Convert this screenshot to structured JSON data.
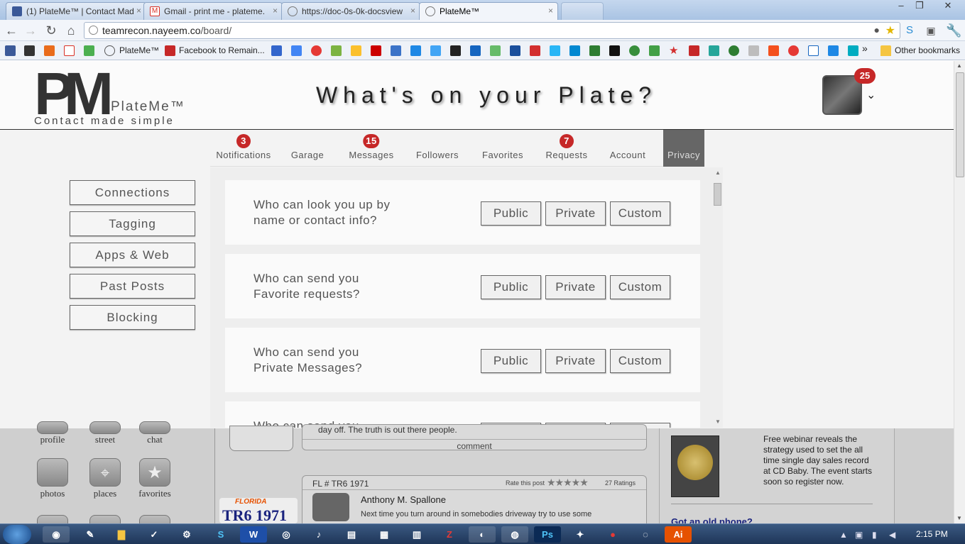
{
  "browser": {
    "tabs": [
      {
        "title": "(1) PlateMe™ | Contact Mad",
        "favicon": "facebook-icon",
        "color": "#3b5998"
      },
      {
        "title": "Gmail - print me - plateme.",
        "favicon": "gmail-icon",
        "color": "#d93025"
      },
      {
        "title": "https://doc-0s-0k-docsview",
        "favicon": "globe-icon",
        "color": "#777777"
      },
      {
        "title": "PlateMe™",
        "favicon": "globe-icon",
        "color": "#777777",
        "active": true
      }
    ],
    "url_domain": "teamrecon.nayeem.co",
    "url_path": "/board/",
    "bookmarks": {
      "plateme": "PlateMe™",
      "facebook_remain": "Facebook to Remain...",
      "other": "Other bookmarks"
    }
  },
  "header": {
    "logo_mark": "PM",
    "logo_name": "PlateMe™",
    "logo_tagline": "Contact made simple",
    "slogan": "What's on your Plate?",
    "avatar_badge": "25"
  },
  "nav": {
    "items": [
      {
        "label": "Notifications",
        "badge": "3"
      },
      {
        "label": "Garage"
      },
      {
        "label": "Messages",
        "badge": "15"
      },
      {
        "label": "Followers"
      },
      {
        "label": "Favorites"
      },
      {
        "label": "Requests",
        "badge": "7"
      },
      {
        "label": "Account"
      },
      {
        "label": "Privacy",
        "active": true
      }
    ]
  },
  "left_menu": [
    "Connections",
    "Tagging",
    "Apps & Web",
    "Past Posts",
    "Blocking"
  ],
  "privacy": {
    "options": [
      "Public",
      "Private",
      "Custom"
    ],
    "questions": [
      {
        "line1": "Who can look you up by",
        "line2": "name or contact info?"
      },
      {
        "line1": "Who can send you",
        "line2": "Favorite requests?"
      },
      {
        "line1": "Who can send you",
        "line2": "Private Messages?"
      },
      {
        "line1": "Who can send you",
        "line2": ""
      }
    ]
  },
  "background": {
    "apps": [
      "profile",
      "street",
      "chat",
      "photos",
      "places",
      "favorites"
    ],
    "post1_text": "day off. The truth is out there people.",
    "comment_label": "comment",
    "post2": {
      "plate": "FL # TR6 1971",
      "rate_label": "Rate this post",
      "ratings": "27 Ratings",
      "author": "Anthony M. Spallone",
      "text": "Next time you turn around in somebodies driveway try to use some",
      "plate_state": "FLORIDA",
      "plate_number": "TR6 1971"
    },
    "ad_text": "Free webinar reveals the strategy used to set the all time single day sales record at CD Baby. The event starts soon so register now.",
    "ad_link": "Got an old phone?"
  },
  "taskbar": {
    "clock": "2:15 PM"
  }
}
